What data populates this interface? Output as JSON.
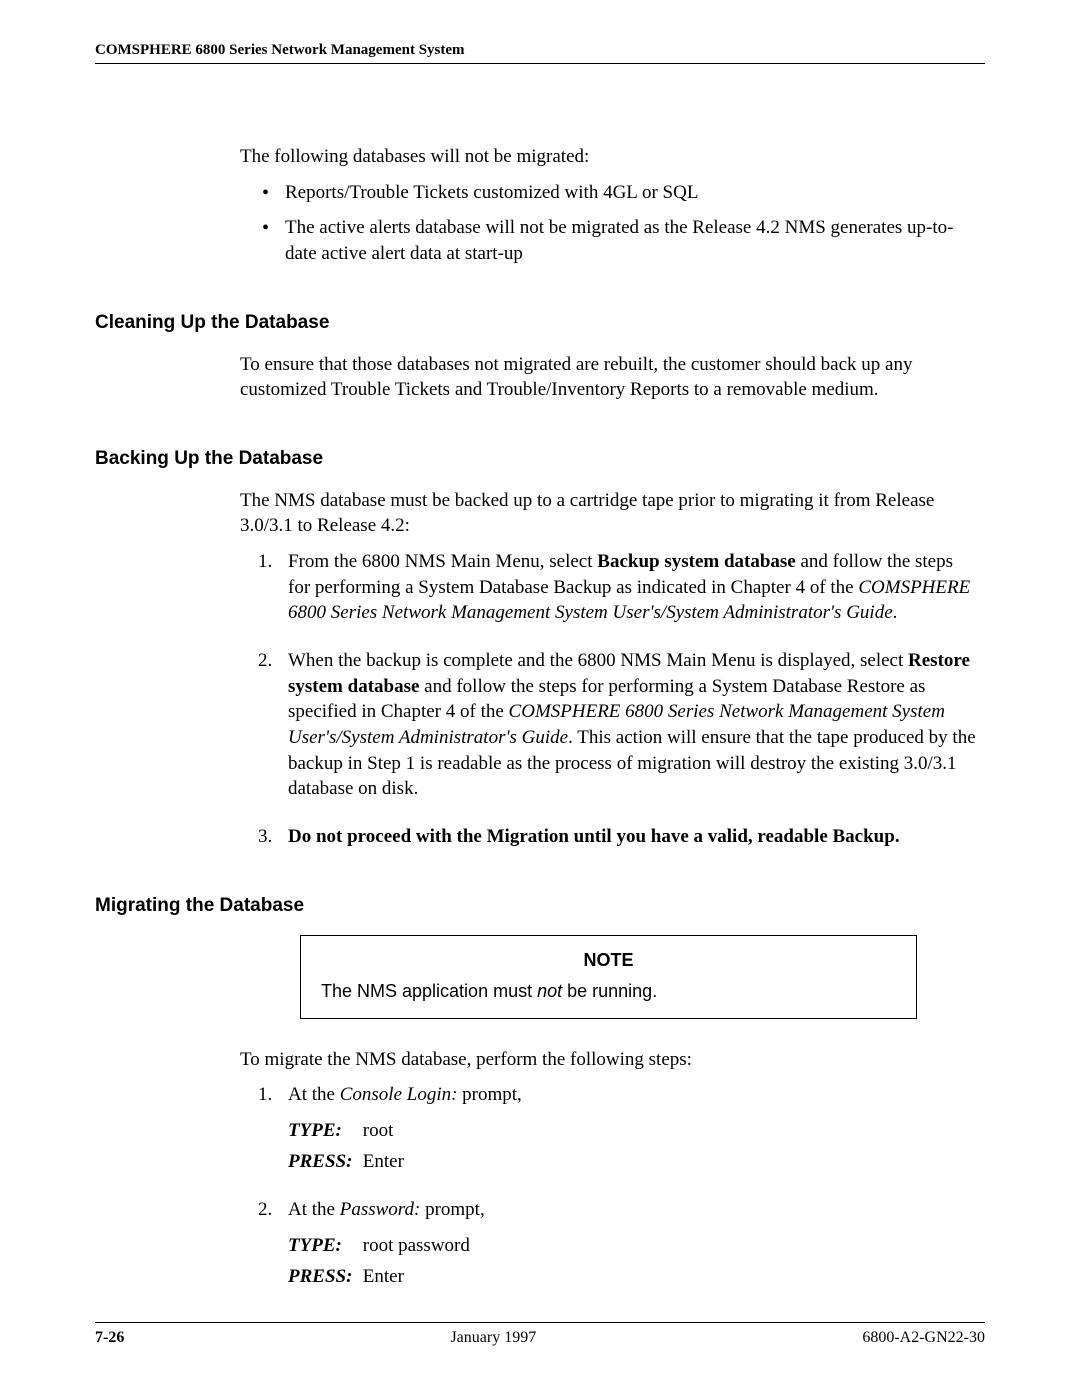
{
  "header": {
    "running_head": "COMSPHERE 6800 Series Network Management System"
  },
  "intro": {
    "lead": "The following databases will not be migrated:",
    "bullets": [
      "Reports/Trouble Tickets customized with 4GL or SQL",
      "The active alerts database will not be migrated as the Release 4.2 NMS generates up-to-date active alert data at start-up"
    ]
  },
  "sections": {
    "cleaning": {
      "title": "Cleaning Up the Database",
      "para": "To ensure that those databases not migrated are rebuilt, the customer should back up any customized Trouble Tickets and Trouble/Inventory Reports to a removable medium."
    },
    "backing": {
      "title": "Backing Up the Database",
      "para": "The NMS database must be backed up to a cartridge tape prior to migrating it from Release 3.0/3.1 to Release 4.2:",
      "step1": {
        "pre": "From the 6800 NMS Main Menu, select ",
        "bold": "Backup system database",
        "mid": " and follow the steps for performing a System Database Backup as indicated in Chapter 4 of the ",
        "ital": "COMSPHERE 6800 Series Network Management System User's/System Administrator's Guide",
        "post": "."
      },
      "step2": {
        "pre": "When the backup is complete and the 6800 NMS Main Menu is displayed, select ",
        "bold": "Restore system database",
        "mid": " and follow the steps for performing a System Database Restore as specified in Chapter 4 of the ",
        "ital": "COMSPHERE 6800 Series Network Management System User's/System Administrator's Guide",
        "post": ". This action will ensure that the tape produced by the backup in Step 1 is readable as the process of migration will destroy the existing 3.0/3.1 database on disk."
      },
      "step3": "Do not proceed with the Migration until you have a valid, readable Backup."
    },
    "migrating": {
      "title": "Migrating the Database",
      "note_title": "NOTE",
      "note_pre": "The NMS application must ",
      "note_not": "not",
      "note_post": " be running.",
      "para": "To migrate the NMS database, perform the following steps:",
      "step1": {
        "pre": "At the ",
        "ital": "Console Login:",
        "post": " prompt,",
        "type_label": "TYPE:",
        "type_val": "root",
        "press_label": "PRESS:",
        "press_val": "Enter"
      },
      "step2": {
        "pre": "At the ",
        "ital": "Password:",
        "post": " prompt,",
        "type_label": "TYPE:",
        "type_val": "root password",
        "press_label": "PRESS:",
        "press_val": "Enter"
      }
    }
  },
  "footer": {
    "page_number": "7-26",
    "date": "January 1997",
    "doc_id": "6800-A2-GN22-30"
  }
}
